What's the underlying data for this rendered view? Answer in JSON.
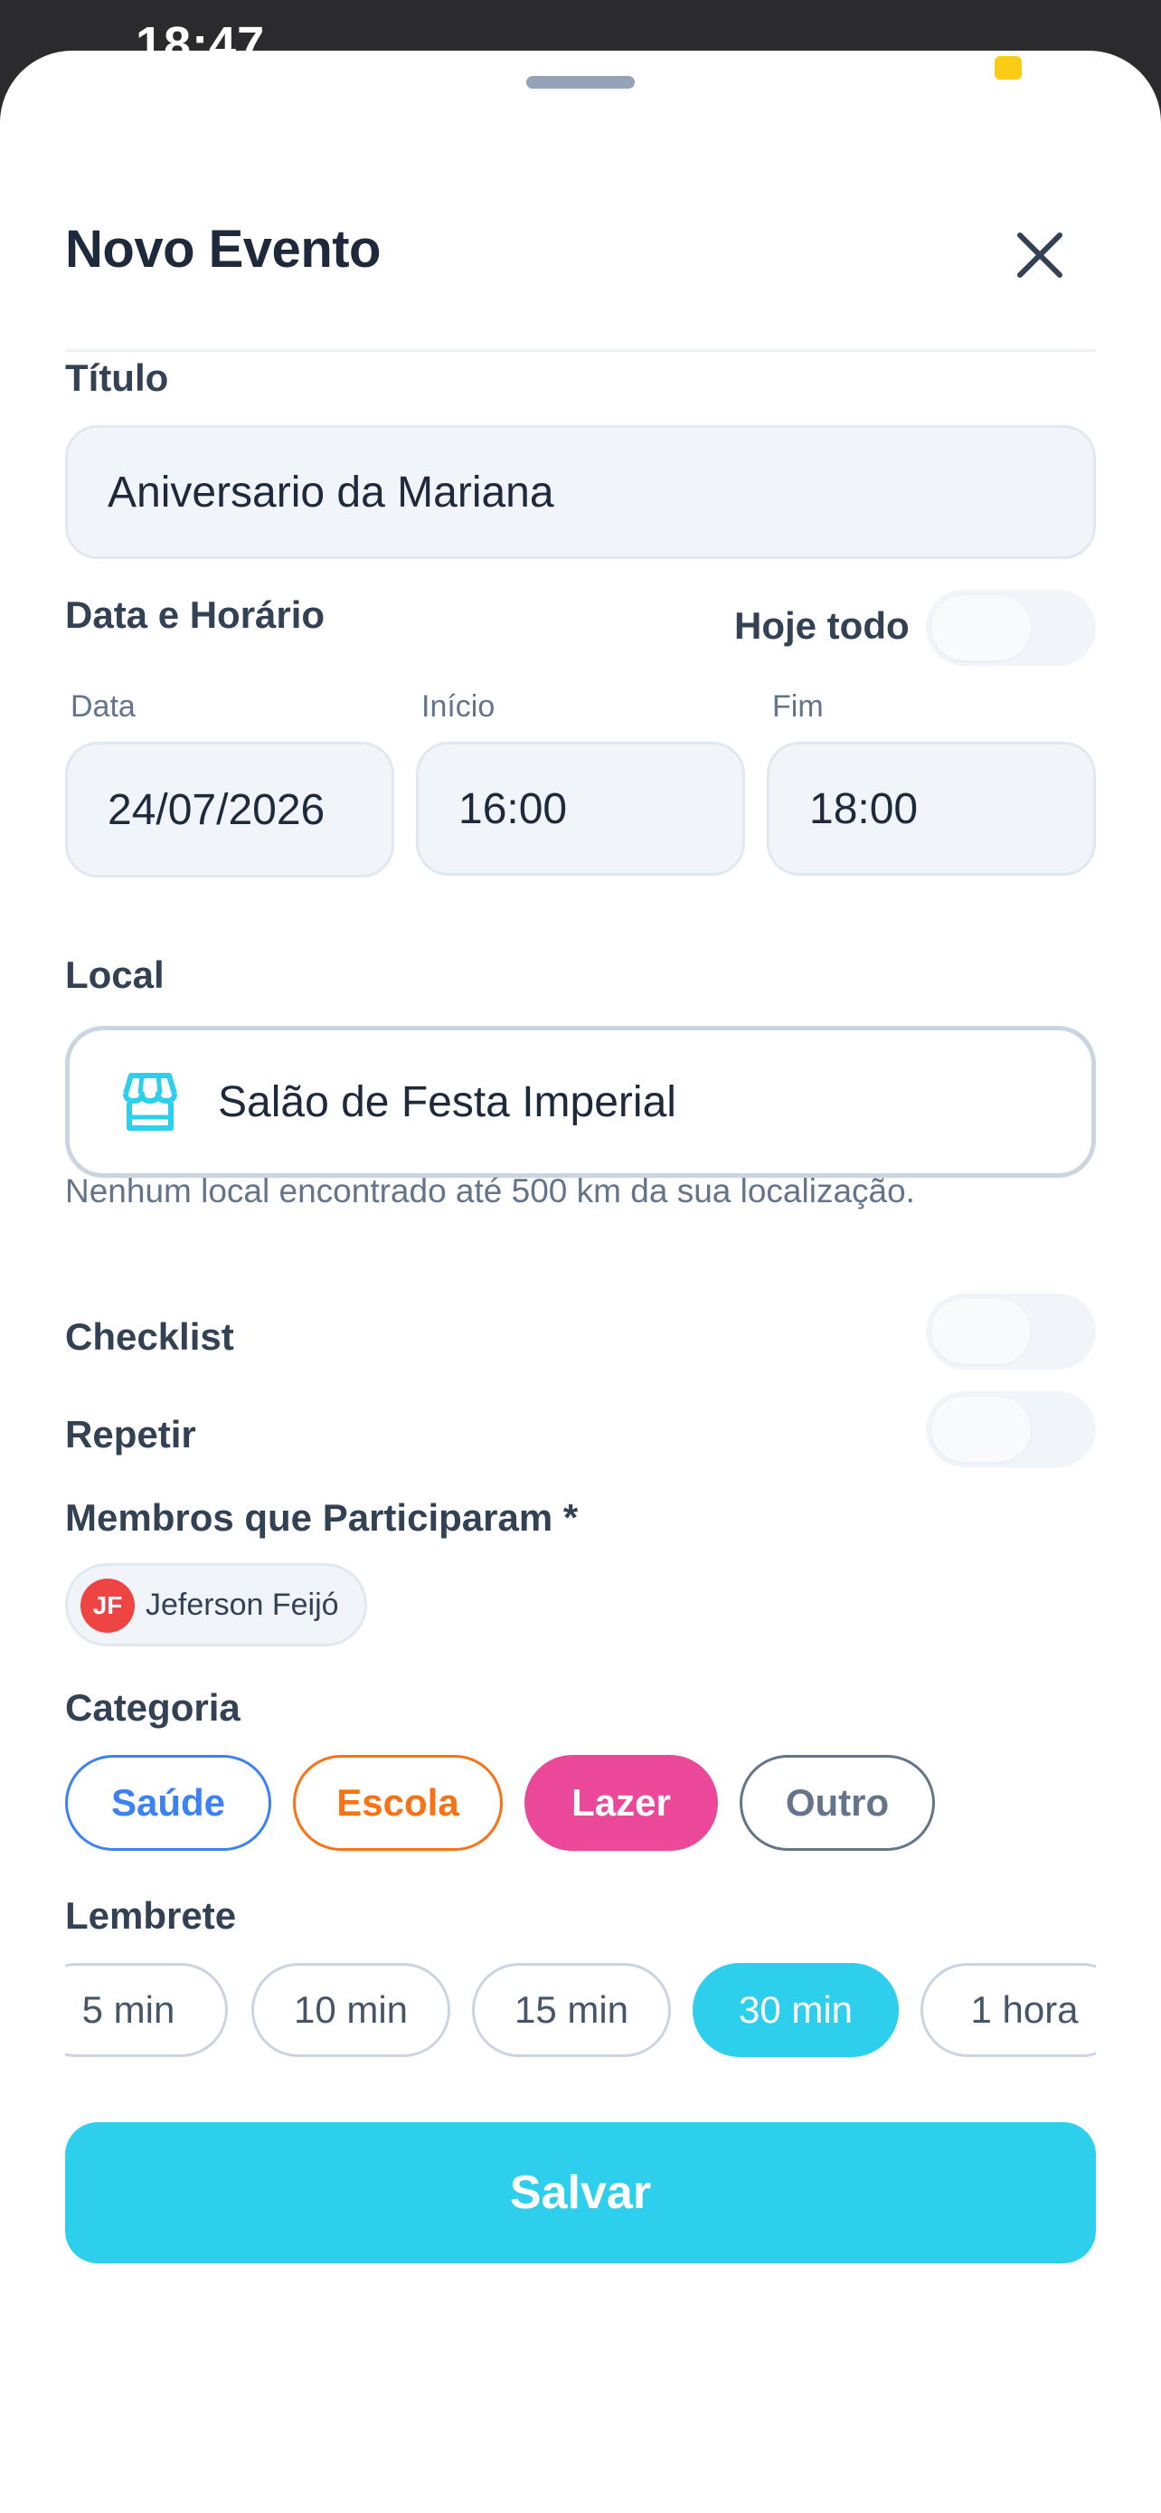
{
  "status_bar": {
    "time": "18:47",
    "indicator_color": "#facc15"
  },
  "sheet": {
    "title": "Novo Evento",
    "close_icon": "close-icon"
  },
  "form": {
    "titulo_label": "Título",
    "titulo_value": "Aniversario da Mariana",
    "datetime_label": "Data e Horário",
    "all_day_label": "Hoje todo",
    "all_day_on": false,
    "date_label": "Data",
    "date_value": "24/07/2026",
    "start_label": "Início",
    "start_value": "16:00",
    "end_label": "Fim",
    "end_value": "18:00",
    "local_label": "Local",
    "local_icon": "storefront-icon",
    "local_value": "Salão de Festa Imperial",
    "local_hint": "Nenhum local encontrado até 500 km da sua localização.",
    "checklist_label": "Checklist",
    "checklist_on": false,
    "repeat_label": "Repetir",
    "repeat_on": false,
    "members_label": "Membros que Participaram *",
    "members": [
      {
        "initials": "JF",
        "name": "Jeferson Feijó",
        "color": "#ef4444"
      }
    ],
    "category_label": "Categoria",
    "categories": [
      {
        "label": "Saúde",
        "color": "#3b82f6",
        "selected": false
      },
      {
        "label": "Escola",
        "color": "#f97316",
        "selected": false
      },
      {
        "label": "Lazer",
        "color": "#ec4899",
        "selected": true
      },
      {
        "label": "Outro",
        "color": "#64748b",
        "selected": false
      }
    ],
    "reminder_label": "Lembrete",
    "reminders": [
      {
        "label": "5 min",
        "selected": false
      },
      {
        "label": "10 min",
        "selected": false
      },
      {
        "label": "15 min",
        "selected": false
      },
      {
        "label": "30 min",
        "selected": true
      },
      {
        "label": "1 hora",
        "selected": false
      }
    ],
    "save_label": "Salvar"
  },
  "colors": {
    "accent": "#2dcfed",
    "title": "#1e293b",
    "muted": "#64748b"
  }
}
